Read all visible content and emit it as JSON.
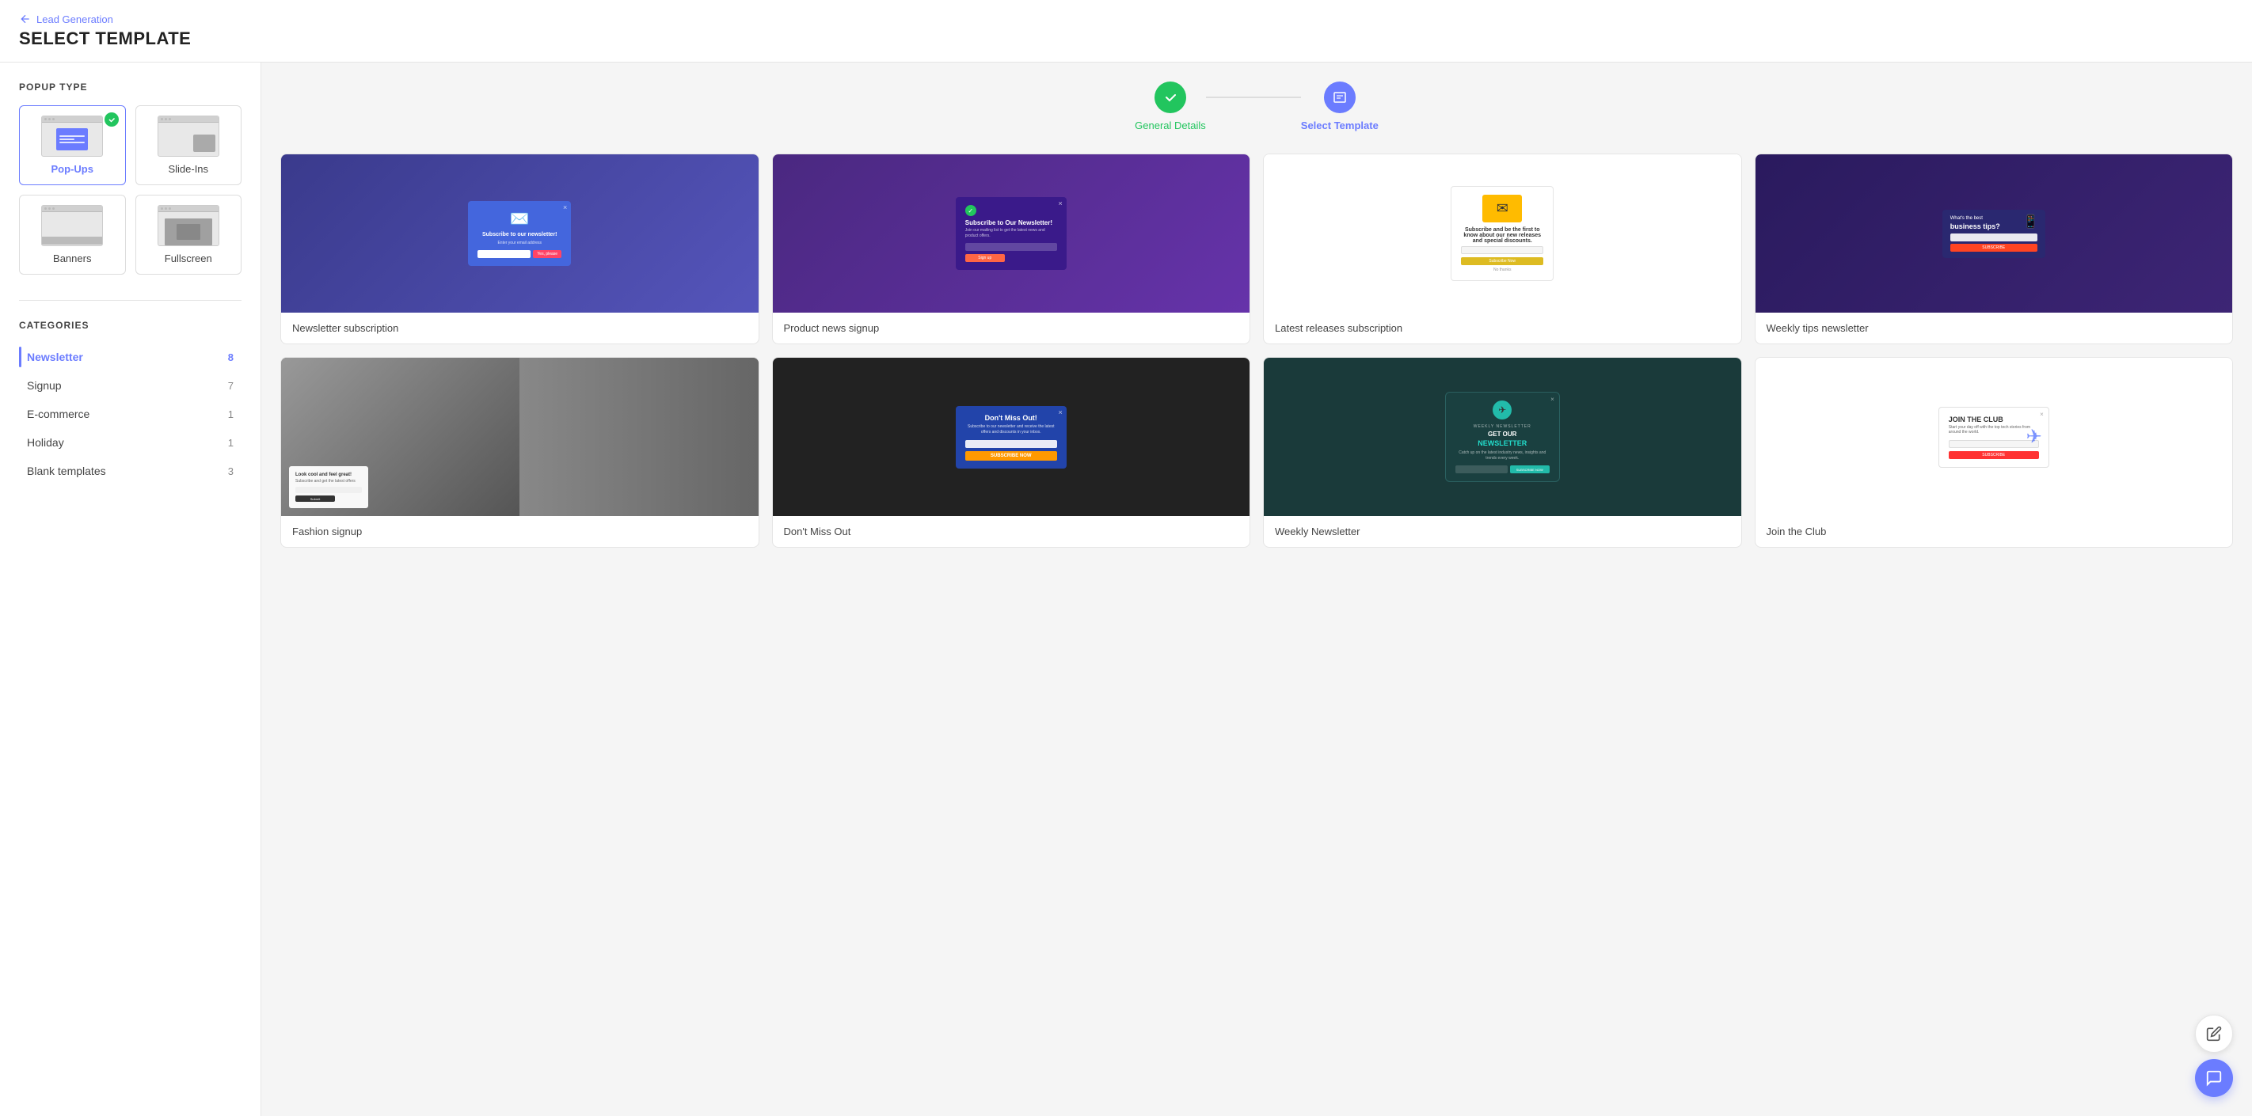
{
  "breadcrumb": {
    "label": "Lead Generation"
  },
  "page": {
    "title": "SELECT TEMPLATE"
  },
  "steps": [
    {
      "id": "general-details",
      "label": "General Details",
      "state": "done"
    },
    {
      "id": "select-template",
      "label": "Select Template",
      "state": "active"
    }
  ],
  "sidebar": {
    "popup_type_section": "POPUP TYPE",
    "popup_types": [
      {
        "id": "popup-ups",
        "label": "Pop-Ups",
        "selected": true
      },
      {
        "id": "slide-ins",
        "label": "Slide-Ins",
        "selected": false
      },
      {
        "id": "banners",
        "label": "Banners",
        "selected": false
      },
      {
        "id": "fullscreen",
        "label": "Fullscreen",
        "selected": false
      }
    ],
    "categories_section": "CATEGORIES",
    "categories": [
      {
        "id": "newsletter",
        "label": "Newsletter",
        "count": 8,
        "active": true
      },
      {
        "id": "signup",
        "label": "Signup",
        "count": 7,
        "active": false
      },
      {
        "id": "ecommerce",
        "label": "E-commerce",
        "count": 1,
        "active": false
      },
      {
        "id": "holiday",
        "label": "Holiday",
        "count": 1,
        "active": false
      },
      {
        "id": "blank",
        "label": "Blank templates",
        "count": 3,
        "active": false
      }
    ]
  },
  "templates": [
    {
      "id": "newsletter-subscription",
      "name": "Newsletter subscription",
      "preview_type": "blue-subscribe"
    },
    {
      "id": "product-news-signup",
      "name": "Product news signup",
      "preview_type": "purple-subscribe"
    },
    {
      "id": "latest-releases-subscription",
      "name": "Latest releases subscription",
      "preview_type": "white-subscribe"
    },
    {
      "id": "weekly-tips-newsletter",
      "name": "Weekly tips newsletter",
      "preview_type": "dark-tips"
    },
    {
      "id": "fashion-signup",
      "name": "Fashion signup",
      "preview_type": "fashion"
    },
    {
      "id": "dont-miss-out",
      "name": "Don't Miss Out",
      "preview_type": "miss-out"
    },
    {
      "id": "weekly-newsletter",
      "name": "Weekly Newsletter",
      "preview_type": "teal-newsletter"
    },
    {
      "id": "join-the-club",
      "name": "Join the Club",
      "preview_type": "club"
    }
  ]
}
